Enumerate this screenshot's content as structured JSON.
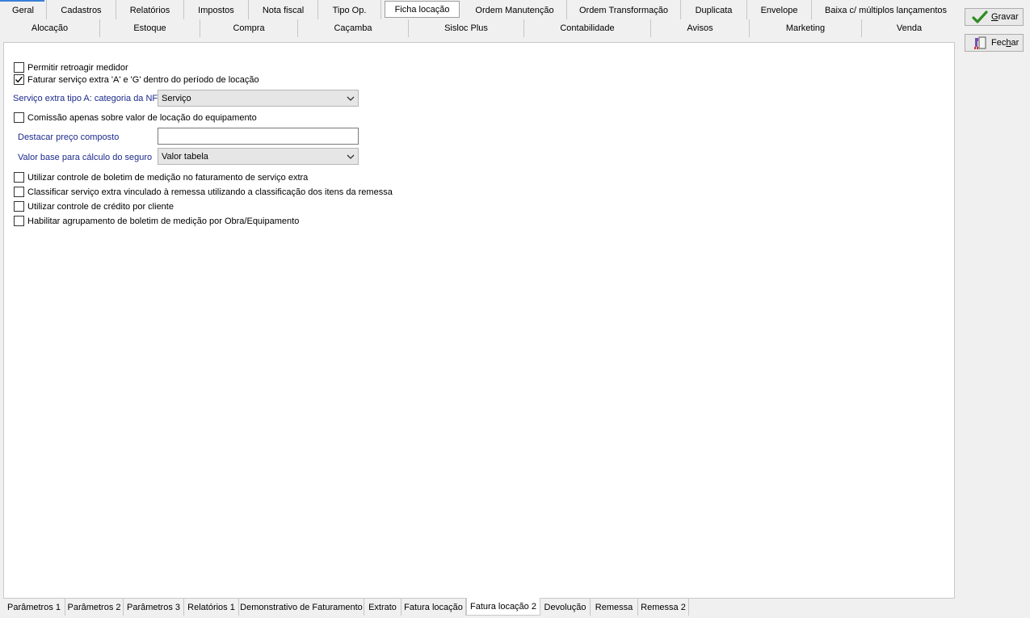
{
  "tabs_row1": [
    {
      "label": "Geral"
    },
    {
      "label": "Cadastros"
    },
    {
      "label": "Relatórios"
    },
    {
      "label": "Impostos"
    },
    {
      "label": "Nota fiscal"
    },
    {
      "label": "Tipo Op."
    },
    {
      "label": "Ficha locação",
      "active": true
    },
    {
      "label": "Ordem Manutenção"
    },
    {
      "label": "Ordem Transformação"
    },
    {
      "label": "Duplicata"
    },
    {
      "label": "Envelope"
    },
    {
      "label": "Baixa c/ múltiplos lançamentos"
    }
  ],
  "tabs_row2": [
    {
      "label": "Alocação"
    },
    {
      "label": "Estoque"
    },
    {
      "label": "Compra"
    },
    {
      "label": "Caçamba"
    },
    {
      "label": "Sisloc Plus"
    },
    {
      "label": "Contabilidade"
    },
    {
      "label": "Avisos"
    },
    {
      "label": "Marketing"
    },
    {
      "label": "Venda"
    }
  ],
  "buttons": {
    "save": {
      "label_pre": "",
      "label_key": "G",
      "label_post": "ravar"
    },
    "close": {
      "label_pre": "Fec",
      "label_key": "h",
      "label_post": "ar"
    }
  },
  "form": {
    "chk_retroagir": {
      "label": "Permitir retroagir medidor",
      "checked": false
    },
    "chk_faturar_extra": {
      "label": "Faturar serviço extra 'A' e 'G' dentro do período de locação",
      "checked": true
    },
    "servico_extra_label": "Serviço extra tipo A: categoria da NF",
    "servico_extra_value": "Serviço",
    "chk_comissao": {
      "label": "Comissão apenas sobre valor de locação do equipamento",
      "checked": false
    },
    "destacar_label": "Destacar preço composto",
    "destacar_value": "",
    "valor_base_label": "Valor base para cálculo do seguro",
    "valor_base_value": "Valor tabela",
    "chk_boletim": {
      "label": "Utilizar controle de boletim de medição no faturamento de serviço extra",
      "checked": false
    },
    "chk_classificar": {
      "label": "Classificar serviço extra vinculado à remessa utilizando a classificação dos itens da remessa",
      "checked": false
    },
    "chk_credito": {
      "label": "Utilizar controle de crédito por cliente",
      "checked": false
    },
    "chk_agrupamento": {
      "label": "Habilitar agrupamento de boletim de medição por Obra/Equipamento",
      "checked": false
    }
  },
  "tabs_bottom": [
    {
      "label": "Parâmetros 1"
    },
    {
      "label": "Parâmetros 2"
    },
    {
      "label": "Parâmetros 3"
    },
    {
      "label": "Relatórios 1"
    },
    {
      "label": "Demonstrativo de Faturamento"
    },
    {
      "label": "Extrato"
    },
    {
      "label": "Fatura locação"
    },
    {
      "label": "Fatura locação 2",
      "active": true
    },
    {
      "label": "Devolução"
    },
    {
      "label": "Remessa"
    },
    {
      "label": "Remessa 2"
    }
  ],
  "colors": {
    "accent_line": "#3a7fd5",
    "label_blue": "#1c2a8c",
    "check_green": "#2e8b22"
  }
}
